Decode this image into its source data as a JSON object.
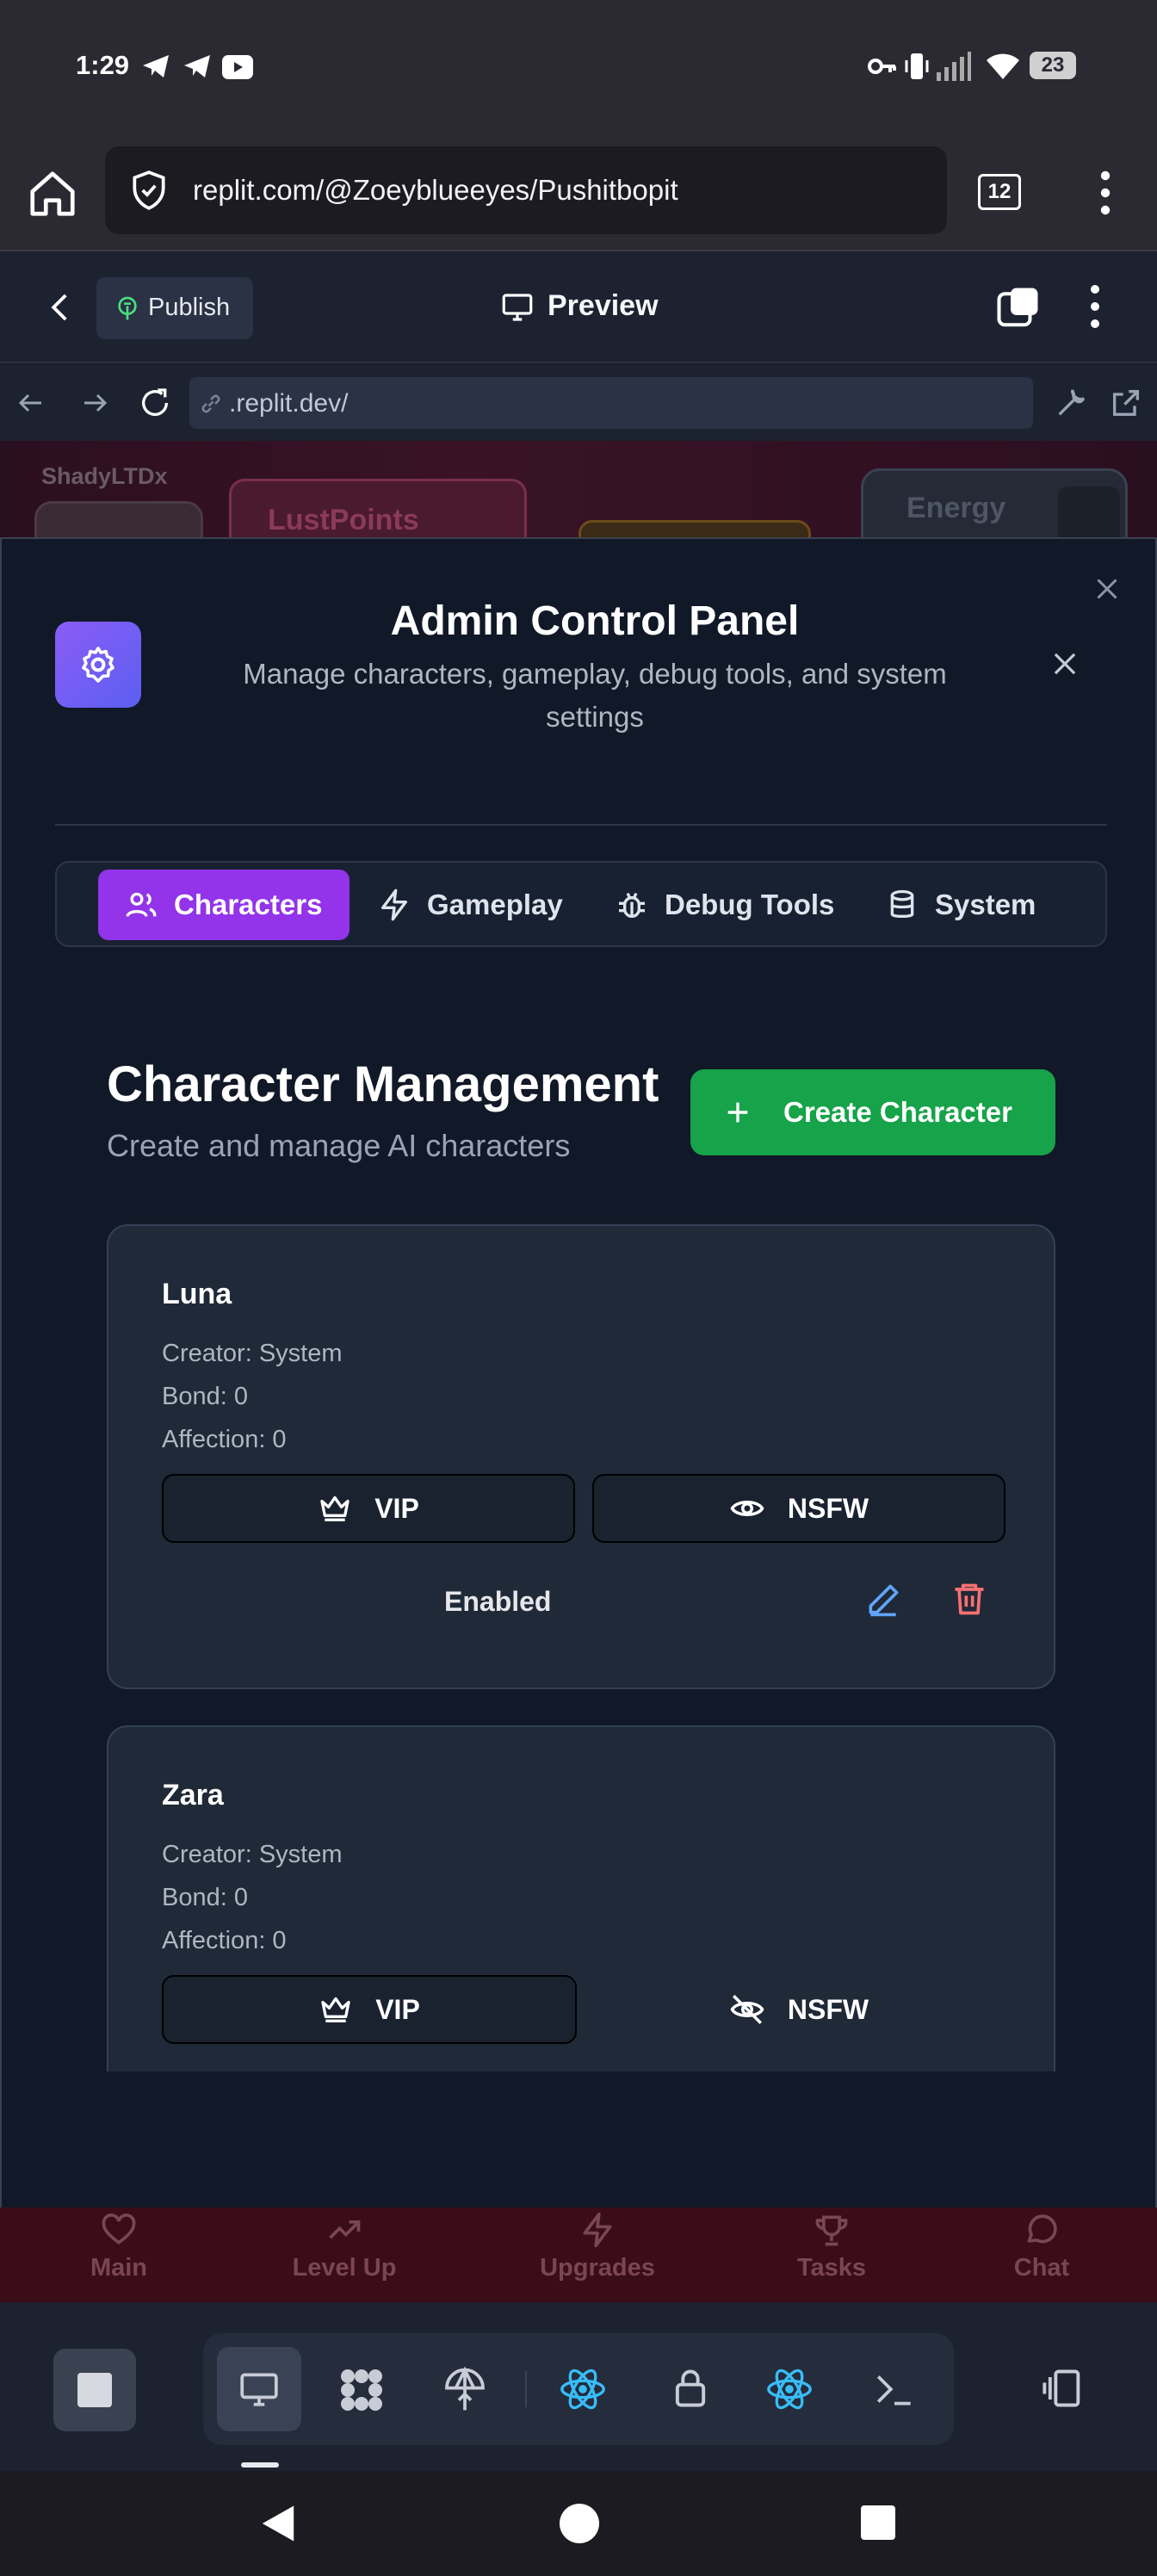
{
  "status_bar": {
    "time": "1:29",
    "battery": "23"
  },
  "browser": {
    "url": "replit.com/@Zoeyblueeyes/Pushitbopit",
    "tab_count": "12"
  },
  "replit": {
    "publish_label": "Publish",
    "preview_label": "Preview",
    "webview_url": ".replit.dev/"
  },
  "game": {
    "username": "ShadyLTDx",
    "lust_points_label": "LustPoints",
    "energy_label": "Energy"
  },
  "admin_panel": {
    "title": "Admin Control Panel",
    "subtitle": "Manage characters, gameplay, debug tools, and system settings",
    "tabs": [
      {
        "label": "Characters",
        "icon": "users-icon",
        "active": true
      },
      {
        "label": "Gameplay",
        "icon": "zap-icon",
        "active": false
      },
      {
        "label": "Debug Tools",
        "icon": "bug-icon",
        "active": false
      },
      {
        "label": "System",
        "icon": "database-icon",
        "active": false
      }
    ],
    "section_title": "Character Management",
    "section_subtitle": "Create and manage AI characters",
    "create_button": "Create Character",
    "characters": [
      {
        "name": "Luna",
        "creator": "Creator: System",
        "bond": "Bond: 0",
        "affection": "Affection: 0",
        "vip_label": "VIP",
        "nsfw_label": "NSFW",
        "status": "Enabled"
      },
      {
        "name": "Zara",
        "creator": "Creator: System",
        "bond": "Bond: 0",
        "affection": "Affection: 0",
        "vip_label": "VIP",
        "nsfw_label": "NSFW"
      }
    ]
  },
  "game_nav": [
    {
      "label": "Main",
      "icon": "heart-icon"
    },
    {
      "label": "Level Up",
      "icon": "trending-up-icon"
    },
    {
      "label": "Upgrades",
      "icon": "zap-icon"
    },
    {
      "label": "Tasks",
      "icon": "trophy-icon"
    },
    {
      "label": "Chat",
      "icon": "chat-icon"
    }
  ],
  "colors": {
    "accent_purple": "#9333ea",
    "create_green": "#16a34a",
    "edit_blue": "#60a5fa",
    "delete_red": "#f87171"
  }
}
